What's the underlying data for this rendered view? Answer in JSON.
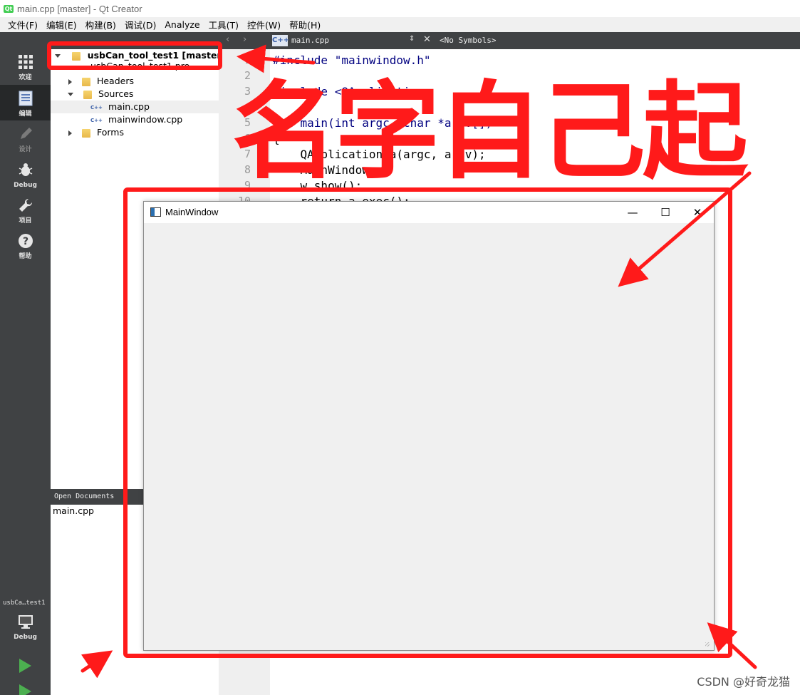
{
  "window": {
    "title": "main.cpp [master] - Qt Creator"
  },
  "menu": [
    "文件(F)",
    "编辑(E)",
    "构建(B)",
    "调试(D)",
    "Analyze",
    "工具(T)",
    "控件(W)",
    "帮助(H)"
  ],
  "modes": [
    {
      "label": "欢迎",
      "icon": "grid-icon"
    },
    {
      "label": "编辑",
      "icon": "edit-document-icon"
    },
    {
      "label": "设计",
      "icon": "pencil-icon"
    },
    {
      "label": "Debug",
      "icon": "bug-icon"
    },
    {
      "label": "项目",
      "icon": "wrench-icon"
    },
    {
      "label": "帮助",
      "icon": "help-icon"
    }
  ],
  "target": {
    "project": "usbCa…test1",
    "config": "Debug"
  },
  "project_tree": {
    "root": "usbCan_tool_test1 [master]",
    "pro_file": "usbCan_tool_test1.pro",
    "headers": "Headers",
    "sources": "Sources",
    "main_cpp": "main.cpp",
    "mainwindow_cpp": "mainwindow.cpp",
    "forms": "Forms"
  },
  "open_documents": {
    "header": "Open Documents",
    "items": [
      "main.cpp"
    ]
  },
  "editor": {
    "file": "main.cpp",
    "symbols": "<No Symbols>",
    "lines": [
      {
        "n": "1",
        "text": "#include \"mainwindow.h\""
      },
      {
        "n": "2",
        "text": ""
      },
      {
        "n": "3",
        "text": "#include <QApplication>"
      },
      {
        "n": "4",
        "text": ""
      },
      {
        "n": "5",
        "text": "int main(int argc, char *argv[])"
      },
      {
        "n": "6",
        "text": "{"
      },
      {
        "n": "7",
        "text": "    QApplication a(argc, argv);"
      },
      {
        "n": "8",
        "text": "    MainWindow w;"
      },
      {
        "n": "9",
        "text": "    w.show();"
      },
      {
        "n": "10",
        "text": "    return a.exec();"
      }
    ]
  },
  "main_window": {
    "title": "MainWindow",
    "minimize": "—",
    "maximize": "☐",
    "close": "✕"
  },
  "annotation": {
    "text": "名字自己起",
    "color": "#ff1a1a"
  },
  "watermark": "CSDN @好奇龙猫"
}
